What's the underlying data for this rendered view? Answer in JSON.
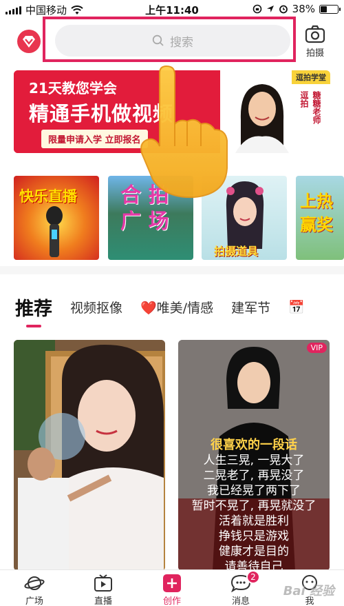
{
  "status": {
    "carrier": "中国移动",
    "time": "上午11:40",
    "battery": "38%",
    "battery_level": 0.38
  },
  "header": {
    "search_placeholder": "搜索",
    "camera_label": "拍摄"
  },
  "banner": {
    "line1": "21天教您学会",
    "line2": "精通手机做视频",
    "cta": "限量申请入学 立即报名",
    "tag": "逗拍学堂",
    "vertical1": "逗拍",
    "vertical2": "糖糖老师"
  },
  "thumbnails": [
    {
      "caption": "快乐直播"
    },
    {
      "caption": "合 拍\n广 场"
    },
    {
      "caption": "拍摄道具"
    },
    {
      "caption": "上热\n赢奖"
    }
  ],
  "tabs": [
    {
      "label": "推荐",
      "active": true
    },
    {
      "label": "视频抠像"
    },
    {
      "label": "❤️唯美/情感"
    },
    {
      "label": "建军节"
    },
    {
      "label": "📅"
    }
  ],
  "cards": {
    "card2": {
      "vip": "VIP",
      "title": "很喜欢的一段话",
      "lines": [
        "人生三晃, 一晃大了",
        "二晃老了, 再晃没了",
        "我已经晃了两下了",
        "暂时不晃了, 再晃就没了",
        "活着就是胜利",
        "挣钱只是游戏",
        "健康才是目的",
        "请善待自己"
      ]
    }
  },
  "nav": [
    {
      "label": "广场",
      "icon": "planet-icon"
    },
    {
      "label": "直播",
      "icon": "tv-icon"
    },
    {
      "label": "创作",
      "icon": "plus-icon",
      "active": true
    },
    {
      "label": "消息",
      "icon": "chat-icon",
      "badge": "2"
    },
    {
      "label": "我",
      "icon": "profile-icon"
    }
  ],
  "watermark": "Bai 经验"
}
